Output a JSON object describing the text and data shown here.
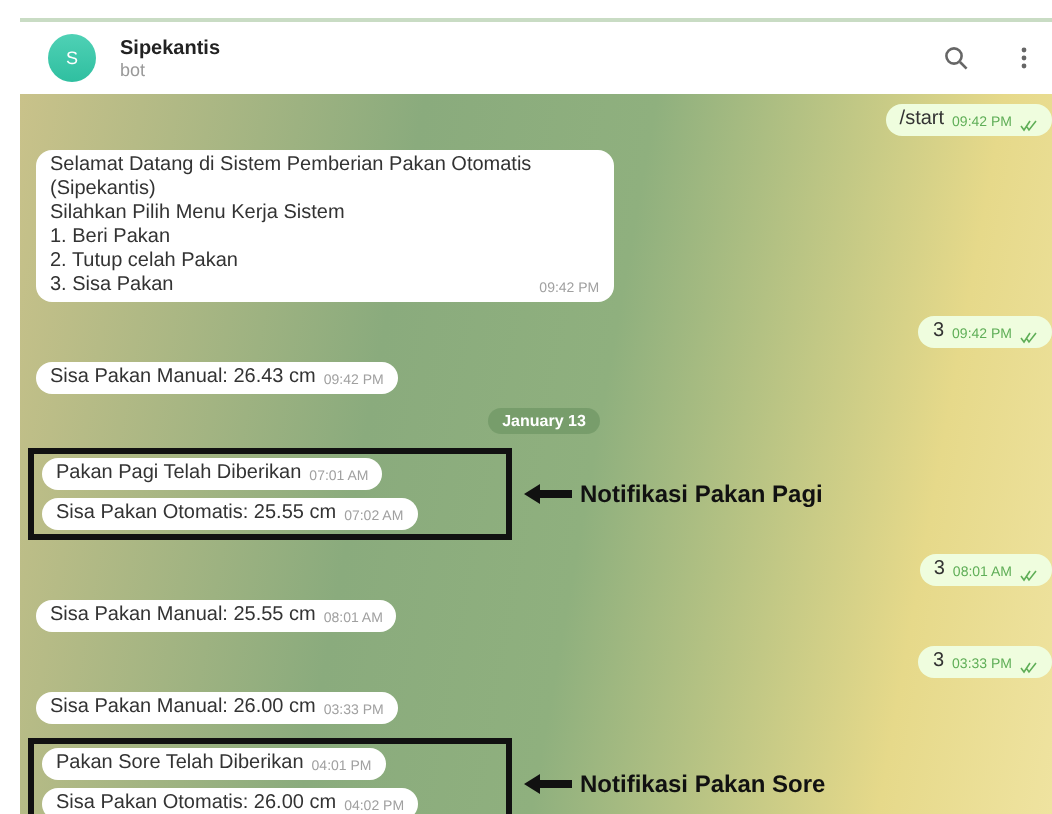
{
  "chat": {
    "avatar_letter": "S",
    "name": "Sipekantis",
    "status": "bot"
  },
  "messages": [
    {
      "kind": "out",
      "text": "/start",
      "time": "09:42 PM"
    },
    {
      "kind": "in",
      "lines": [
        "Selamat Datang di Sistem Pemberian Pakan Otomatis",
        "(Sipekantis)",
        "Silahkan Pilih Menu Kerja Sistem",
        "1. Beri Pakan",
        "2. Tutup celah Pakan",
        "3. Sisa Pakan"
      ],
      "time": "09:42 PM"
    },
    {
      "kind": "out",
      "text": "3",
      "time": "09:42 PM"
    },
    {
      "kind": "in",
      "lines": [
        "Sisa Pakan Manual: 26.43 cm"
      ],
      "time": "09:42 PM"
    },
    {
      "kind": "date",
      "text": "January 13"
    },
    {
      "kind": "group",
      "annotation": "Notifikasi Pakan Pagi",
      "messages": [
        {
          "lines": [
            "Pakan Pagi Telah Diberikan"
          ],
          "time": "07:01 AM"
        },
        {
          "lines": [
            "Sisa Pakan Otomatis: 25.55 cm"
          ],
          "time": "07:02 AM"
        }
      ]
    },
    {
      "kind": "out",
      "text": "3",
      "time": "08:01 AM"
    },
    {
      "kind": "in",
      "lines": [
        "Sisa Pakan Manual: 25.55 cm"
      ],
      "time": "08:01 AM"
    },
    {
      "kind": "out",
      "text": "3",
      "time": "03:33 PM"
    },
    {
      "kind": "in",
      "lines": [
        "Sisa Pakan Manual: 26.00 cm"
      ],
      "time": "03:33 PM"
    },
    {
      "kind": "group",
      "annotation": "Notifikasi Pakan Sore",
      "messages": [
        {
          "lines": [
            "Pakan Sore Telah Diberikan"
          ],
          "time": "04:01 PM"
        },
        {
          "lines": [
            "Sisa Pakan Otomatis: 26.00 cm"
          ],
          "time": "04:02 PM"
        }
      ]
    }
  ]
}
